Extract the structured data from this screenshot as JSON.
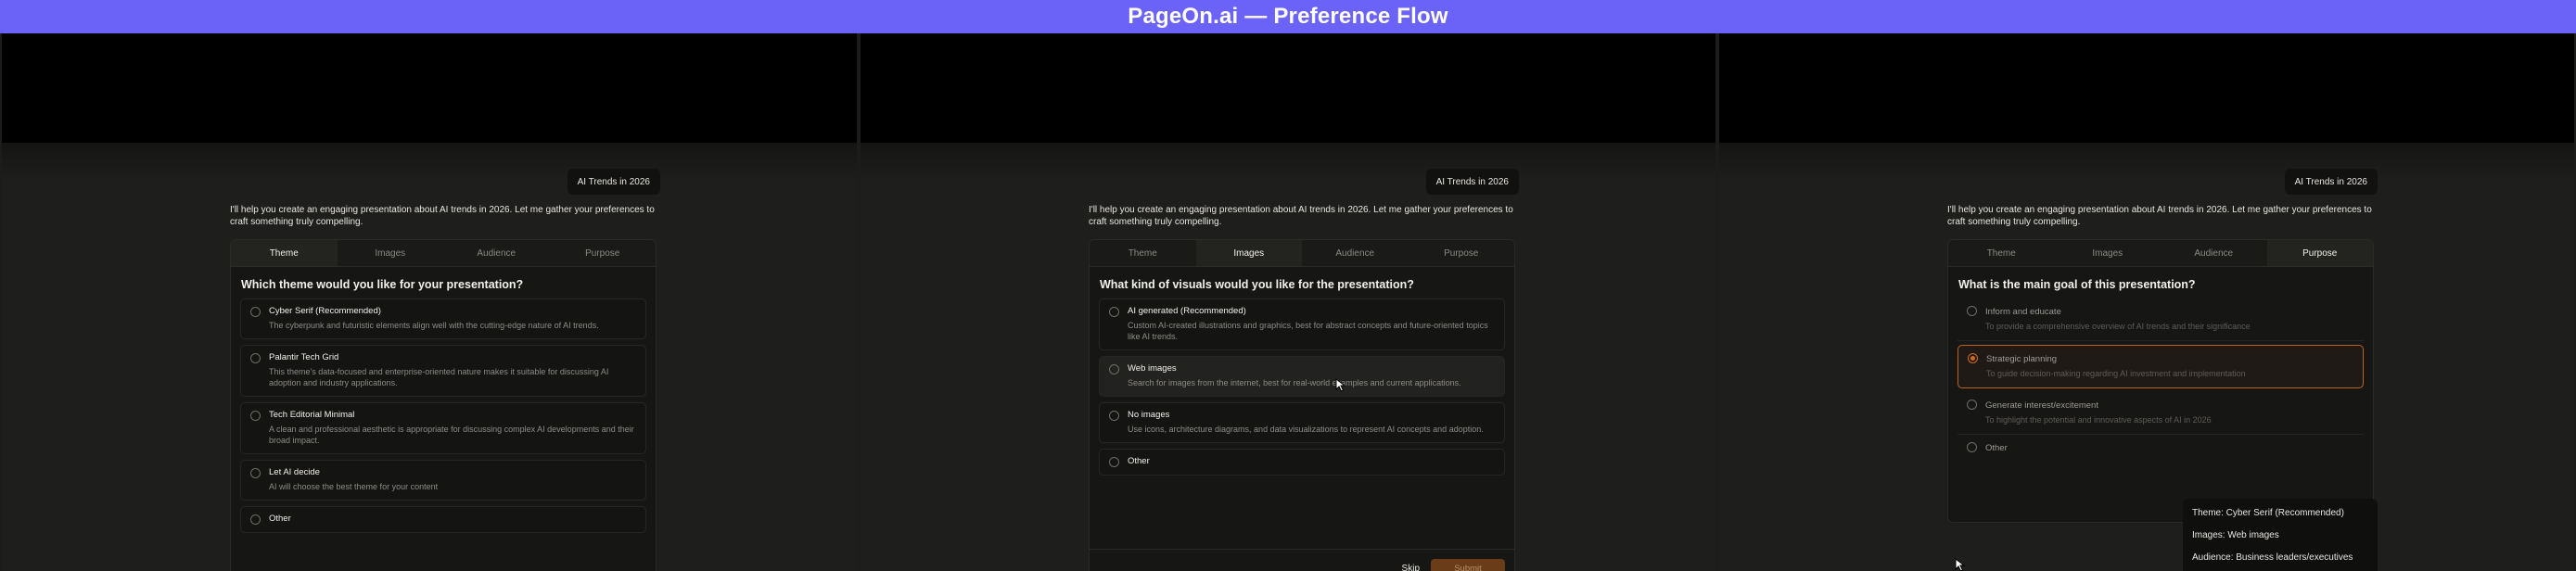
{
  "banner": {
    "title": "PageOn.ai — Preference Flow"
  },
  "shared": {
    "chip": "AI Trends in 2026",
    "intro": "I'll help you create an engaging presentation about AI trends in 2026. Let me gather your preferences to craft something truly compelling.",
    "tabs": [
      "Theme",
      "Images",
      "Audience",
      "Purpose"
    ]
  },
  "panel1": {
    "active_tab": "Theme",
    "question": "Which theme would you like for your presentation?",
    "options": [
      {
        "title": "Cyber Serif (Recommended)",
        "desc": "The cyberpunk and futuristic elements align well with the cutting-edge nature of AI trends."
      },
      {
        "title": "Palantir Tech Grid",
        "desc": "This theme's data-focused and enterprise-oriented nature makes it suitable for discussing AI adoption and industry applications."
      },
      {
        "title": "Tech Editorial Minimal",
        "desc": "A clean and professional aesthetic is appropriate for discussing complex AI developments and their broad impact."
      },
      {
        "title": "Let AI decide",
        "desc": "AI will choose the best theme for your content"
      },
      {
        "title": "Other",
        "desc": ""
      }
    ]
  },
  "panel2": {
    "active_tab": "Images",
    "question": "What kind of visuals would you like for the presentation?",
    "options": [
      {
        "title": "AI generated (Recommended)",
        "desc": "Custom AI-created illustrations and graphics, best for abstract concepts and future-oriented topics like AI trends."
      },
      {
        "title": "Web images",
        "desc": "Search for images from the internet, best for real-world examples and current applications."
      },
      {
        "title": "No images",
        "desc": "Use icons, architecture diagrams, and data visualizations to represent AI concepts and adoption."
      },
      {
        "title": "Other",
        "desc": ""
      }
    ],
    "skip": "Skip",
    "submit": "Submit"
  },
  "panel3": {
    "active_tab": "Purpose",
    "question": "What is the main goal of this presentation?",
    "options": [
      {
        "title": "Inform and educate",
        "desc": "To provide a comprehensive overview of AI trends and their significance"
      },
      {
        "title": "Strategic planning",
        "desc": "To guide decision-making regarding AI investment and implementation"
      },
      {
        "title": "Generate interest/excitement",
        "desc": "To highlight the potential and innovative aspects of AI in 2026"
      },
      {
        "title": "Other",
        "desc": ""
      }
    ],
    "summary": [
      "Theme: Cyber Serif (Recommended)",
      "Images: Web images",
      "Audience: Business leaders/executives"
    ]
  },
  "colors": {
    "banner": "#6b63f8",
    "accent_orange": "#c0631a",
    "submit_bg": "#6a3c17"
  },
  "icons": [
    "radio-icon",
    "cursor-icon"
  ]
}
